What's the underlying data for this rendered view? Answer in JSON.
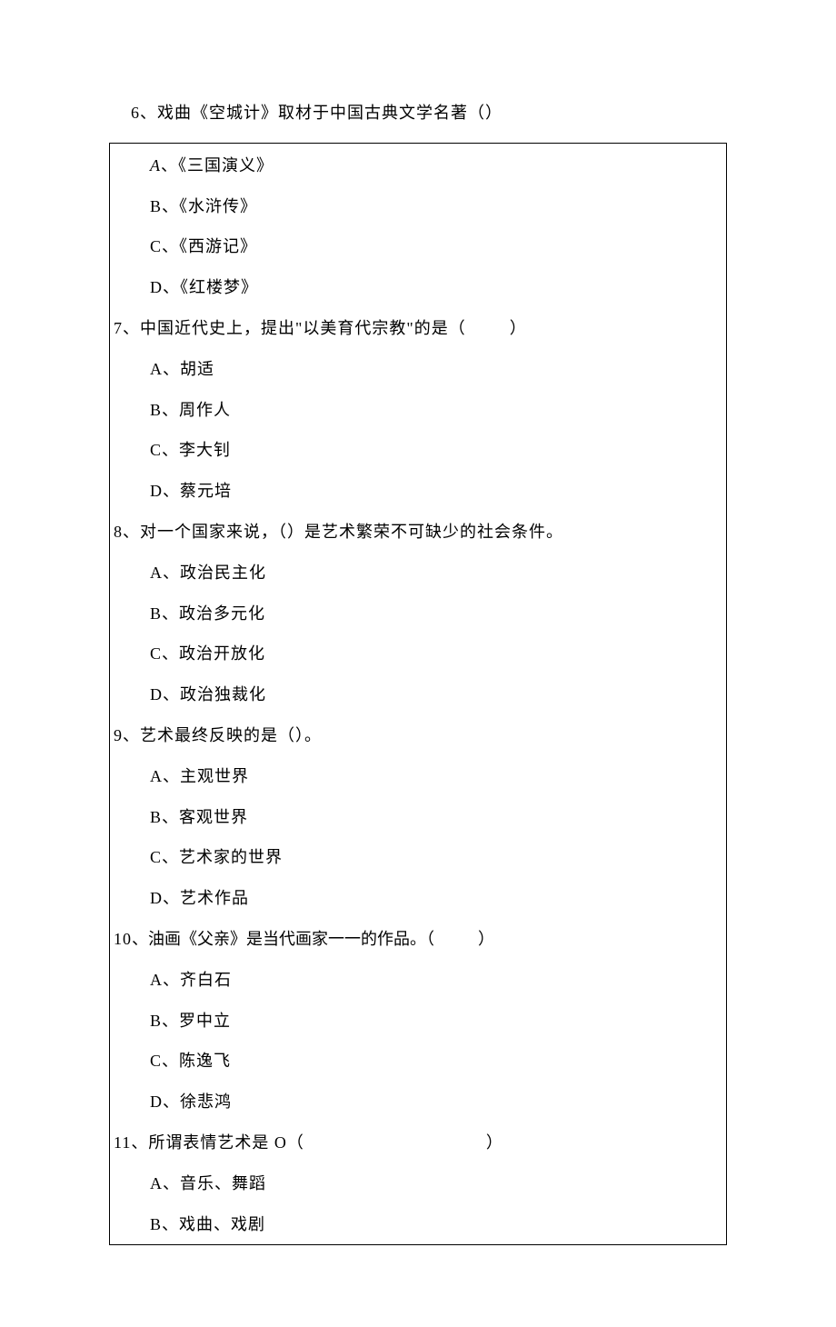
{
  "questions": [
    {
      "number": "6",
      "stem_suffix": "、戏曲《空城计》取材于中国古典文学名著（）",
      "options": [
        {
          "letter": "A",
          "text": "《三国演义》",
          "italic": true
        },
        {
          "letter": "B",
          "text": "《水浒传》"
        },
        {
          "letter": "C",
          "text": "《西游记》"
        },
        {
          "letter": "D",
          "text": "《红楼梦》"
        }
      ]
    },
    {
      "number": "7",
      "stem_prefix": "、中国近代史上，提出\"以美育代宗教\"的是（",
      "stem_suffix": "）",
      "options": [
        {
          "letter": "A",
          "text": "胡适"
        },
        {
          "letter": "B",
          "text": "周作人"
        },
        {
          "letter": "C",
          "text": "李大钊"
        },
        {
          "letter": "D",
          "text": "蔡元培"
        }
      ]
    },
    {
      "number": "8",
      "stem_suffix": "、对一个国家来说，（）是艺术繁荣不可缺少的社会条件。",
      "options": [
        {
          "letter": "A",
          "text": "政治民主化"
        },
        {
          "letter": "B",
          "text": "政治多元化"
        },
        {
          "letter": "C",
          "text": "政治开放化"
        },
        {
          "letter": "D",
          "text": "政治独裁化"
        }
      ]
    },
    {
      "number": "9",
      "stem_suffix": "、艺术最终反映的是（）。",
      "options": [
        {
          "letter": "A",
          "text": "主观世界"
        },
        {
          "letter": "B",
          "text": "客观世界"
        },
        {
          "letter": "C",
          "text": "艺术家的世界"
        },
        {
          "letter": "D",
          "text": "艺术作品"
        }
      ]
    },
    {
      "number": "10",
      "stem_prefix": "、油画《父亲》是当代画家一一的作品。（",
      "stem_suffix": "）",
      "options": [
        {
          "letter": "A",
          "text": "齐白石"
        },
        {
          "letter": "B",
          "text": "罗中立"
        },
        {
          "letter": "C",
          "text": "陈逸飞"
        },
        {
          "letter": "D",
          "text": "徐悲鸿"
        }
      ]
    },
    {
      "number": "11",
      "stem_prefix": "、所谓表情艺术是 O（",
      "stem_suffix": "）",
      "wide_gap": true,
      "options": [
        {
          "letter": "A",
          "text": "音乐、舞蹈"
        },
        {
          "letter": "B",
          "text": "戏曲、戏剧"
        }
      ]
    }
  ]
}
